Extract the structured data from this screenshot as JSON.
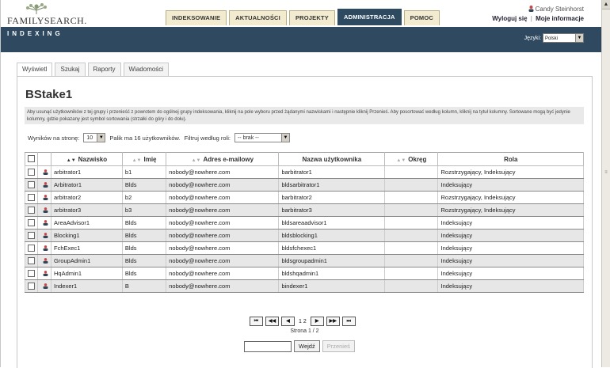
{
  "header": {
    "logo_text": "FAMILYSEARCH.",
    "tabs": [
      "INDEKSOWANIE",
      "AKTUALNOŚCI",
      "PROJEKTY",
      "ADMINISTRACJA",
      "POMOC"
    ],
    "active_tab": "ADMINISTRACJA",
    "user_name": "Candy Steinhorst",
    "logout": "Wyloguj się",
    "separator": "|",
    "my_info": "Moje informacje"
  },
  "band": {
    "title": "INDEXING",
    "language_label": "Języki:",
    "language_value": "Polski"
  },
  "subtabs": [
    "Wyświetl",
    "Szukaj",
    "Raporty",
    "Wiadomości"
  ],
  "panel": {
    "title": "BStake1",
    "info": "Aby usunąć użytkowników z tej grupy i przenieść z powrotem do ogólnej grupy indeksowania, kliknij na pole wyboru przed żądanymi nazwiskami i następnie kliknij Przenieś. Aby posortować według kolumn, kliknij na tytuł kolumny. Sortowane mogą być jedynie kolumny, gdzie pokazany jest symbol sortowania (strzałki do góry i do dołu).",
    "per_page_label": "Wyników na stronę:",
    "per_page_value": "10",
    "count_text": "Palik ma 16 użytkowników.",
    "filter_label": "Filtruj według roli:",
    "filter_value": "-- brak --"
  },
  "table": {
    "headers": {
      "surname": "Nazwisko",
      "name": "Imię",
      "email": "Adres e-mailowy",
      "username": "Nazwa użytkownika",
      "district": "Okręg",
      "role": "Rola"
    },
    "rows": [
      {
        "surname": "arbitrator1",
        "name": "b1",
        "email": "nobody@nowhere.com",
        "username": "barbitrator1",
        "district": "",
        "role": "Rozstrzygający,  Indeksujący"
      },
      {
        "surname": "Arbitrator1",
        "name": "Blds",
        "email": "nobody@nowhere.com",
        "username": "bldsarbitrator1",
        "district": "",
        "role": "Indeksujący"
      },
      {
        "surname": "arbitrator2",
        "name": "b2",
        "email": "nobody@nowhere.com",
        "username": "barbitrator2",
        "district": "",
        "role": "Rozstrzygający,  Indeksujący"
      },
      {
        "surname": "arbitrator3",
        "name": "b3",
        "email": "nobody@nowhere.com",
        "username": "barbitrator3",
        "district": "",
        "role": "Rozstrzygający,  Indeksujący"
      },
      {
        "surname": "AreaAdvisor1",
        "name": "Blds",
        "email": "nobody@nowhere.com",
        "username": "bldsareaadvisor1",
        "district": "",
        "role": "Indeksujący"
      },
      {
        "surname": "Blocking1",
        "name": "Blds",
        "email": "nobody@nowhere.com",
        "username": "bldsblocking1",
        "district": "",
        "role": "Indeksujący"
      },
      {
        "surname": "FchExec1",
        "name": "Blds",
        "email": "nobody@nowhere.com",
        "username": "bldsfchexec1",
        "district": "",
        "role": "Indeksujący"
      },
      {
        "surname": "GroupAdmin1",
        "name": "Blds",
        "email": "nobody@nowhere.com",
        "username": "bldsgroupadmin1",
        "district": "",
        "role": "Indeksujący"
      },
      {
        "surname": "HqAdmin1",
        "name": "Blds",
        "email": "nobody@nowhere.com",
        "username": "bldshqadmin1",
        "district": "",
        "role": "Indeksujący"
      },
      {
        "surname": "Indexer1",
        "name": "B",
        "email": "nobody@nowhere.com",
        "username": "bindexer1",
        "district": "",
        "role": "Indeksujący"
      }
    ]
  },
  "pager": {
    "first": "⏮",
    "prev_page": "◀◀",
    "prev": "◀",
    "pages": "1 2",
    "next": "▶",
    "next_page": "▶▶",
    "last": "⏭",
    "page_info": "Strona 1 / 2",
    "go_label": "Wejdź",
    "move_label": "Przenieś"
  },
  "colors": {
    "band": "#2f4a60",
    "tab_bg": "#f3ebcf",
    "row_alt": "#e7e7e7"
  }
}
